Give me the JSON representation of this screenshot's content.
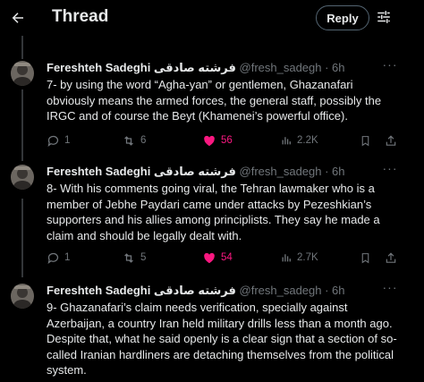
{
  "header": {
    "title": "Thread",
    "reply_label": "Reply"
  },
  "colors": {
    "background": "#000000",
    "text": "#e7e9ea",
    "muted": "#71767b",
    "like": "#f91880",
    "border": "#333639"
  },
  "tweets": [
    {
      "name": "Fereshteh Sadeghi فرشته صادقی",
      "handle": "@fresh_sadegh · 6h",
      "text": "7- by using the word “Agha-yan” or gentlemen, Ghazanafari obviously means the armed forces, the general staff, possibly the IRGC and of course the Beyt (Khamenei’s powerful office).",
      "replies": "1",
      "retweets": "6",
      "likes": "56",
      "views": "2.2K"
    },
    {
      "name": "Fereshteh Sadeghi فرشته صادقی",
      "handle": "@fresh_sadegh · 6h",
      "text": "8- With his comments going viral, the Tehran lawmaker who is a member of Jebhe Paydari came under attacks by Pezeshkian’s supporters and his allies among principlists. They say he made a claim and should be legally dealt with.",
      "replies": "1",
      "retweets": "5",
      "likes": "54",
      "views": "2.7K"
    },
    {
      "name": "Fereshteh Sadeghi فرشته صادقی",
      "handle": "@fresh_sadegh · 6h",
      "text": "9- Ghazanafari’s claim needs verification, specially against Azerbaijan, a country Iran held military drills less than a month ago. Despite that, what he said openly is a clear sign that a section of so-called Iranian hardliners are detaching themselves from the political system."
    }
  ]
}
